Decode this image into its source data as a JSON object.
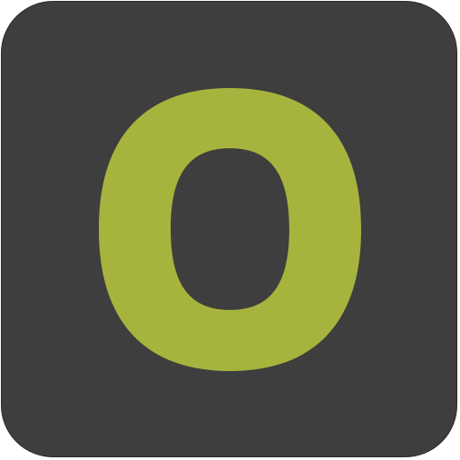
{
  "icon": {
    "name": "o-letter-icon",
    "colors": {
      "background": "#3e3e3e",
      "border": "#2b2b2b",
      "glyph": "#a6b43d"
    }
  }
}
